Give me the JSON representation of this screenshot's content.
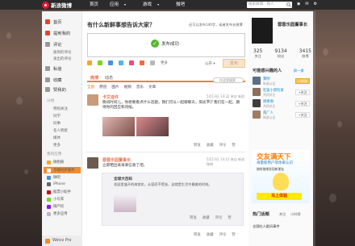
{
  "topbar": {
    "brand": "新浪微博",
    "nav": [
      {
        "label": "首页",
        "dropdown": false
      },
      {
        "label": "应用",
        "dropdown": true
      },
      {
        "label": "游戏",
        "dropdown": true
      },
      {
        "label": "微吧",
        "dropdown": false
      }
    ],
    "search_placeholder": "搜索微博、找人",
    "icons": [
      "user-icon",
      "message-icon",
      "gear-icon"
    ]
  },
  "leftnav": {
    "items": [
      {
        "label": "首页",
        "icon": "home-icon"
      },
      {
        "label": "提到我的",
        "icon": "at-icon"
      },
      {
        "label": "评论",
        "icon": "comment-icon"
      },
      {
        "label": "私信",
        "icon": "mail-icon"
      },
      {
        "label": "收藏",
        "icon": "star-icon"
      },
      {
        "label": "赞我的",
        "icon": "like-icon"
      }
    ],
    "sub_items": [
      "收到的评论",
      "发出的评论"
    ],
    "group_title": "分组",
    "groups": [
      "特别关注",
      "同学",
      "同事",
      "名人明星",
      "媒体",
      "更多"
    ],
    "apps_title": "我的应用",
    "apps": [
      "微相册",
      "云端同步服务",
      "微吧",
      "iPhone",
      "股票小助手",
      "小号库",
      "微产权",
      "更多应用"
    ],
    "weico": "Weico Pro"
  },
  "composer": {
    "title": "有什么新鲜事想告诉大家？",
    "hint": "还可以发布140字，或者发布长微博",
    "success_text": "发布成功",
    "tools": [
      "表情",
      "图片",
      "视频",
      "话题",
      "长微博",
      "音乐",
      "其他"
    ],
    "more_label": "更多",
    "publish_scope": "公开",
    "publish_button": "发布"
  },
  "tabs": {
    "items": [
      "微博",
      "动态"
    ],
    "filters": [
      "全部",
      "原创",
      "图片",
      "视频",
      "音乐",
      "文章"
    ],
    "search_placeholder": "在这里搜索"
  },
  "feed": [
    {
      "name": "卡文迪许",
      "time": "5月13日 14:32 来自 新浪微博",
      "text": "晚间时间儿，你想要看点什么话题，我们可以一起聊聊天，阳光下，我们在一起，期待你的回应和问候。",
      "actions": [
        "转发",
        "收藏",
        "评论",
        "赞"
      ]
    },
    {
      "name": "蓉蓉乐园董事长",
      "time": "5月13日 14:21 来自 新浪微博",
      "text": "立即晒出采采来信收了吧。",
      "quote_title": "全球大百科",
      "quote_text": "花园里盛开的海棠花，从容而不慌张，这就是生活中最美的时刻。",
      "actions": [
        "转发",
        "收藏",
        "评论",
        "赞"
      ]
    }
  ],
  "profile": {
    "name": "蓉蓉乐园董事长",
    "stats": [
      {
        "value": "325",
        "label": "关注"
      },
      {
        "value": "9134",
        "label": "粉丝"
      },
      {
        "value": "3415",
        "label": "微博"
      }
    ]
  },
  "recommend": {
    "title": "可能感兴趣的人",
    "link": "换一换",
    "people": [
      {
        "name": "黎明",
        "sub": "新浪认证",
        "action": "+关注",
        "highlight": true
      },
      {
        "name": "吃饭小冒险家",
        "sub": "共同关注",
        "action": "+关注",
        "highlight": false
      },
      {
        "name": "谢谢谢",
        "sub": "共同关注",
        "action": "+关注",
        "highlight": false
      },
      {
        "name": "南广人",
        "sub": "新浪认证",
        "action": "+关注",
        "highlight": false
      }
    ]
  },
  "ad": {
    "headline": "交友满天下",
    "sub": "海量新用户等你来认识",
    "small": "随时随地发现新朋友",
    "cta": "马上体验"
  },
  "hot": {
    "title": "热门话题",
    "tabs": [
      "关注",
      "小时榜"
    ],
    "first": "全国吃人跟风事件"
  },
  "colors": {
    "accent": "#f07d3c",
    "active_nav": "#f28b30",
    "link": "#0a8cd2",
    "success": "#58b72f"
  }
}
